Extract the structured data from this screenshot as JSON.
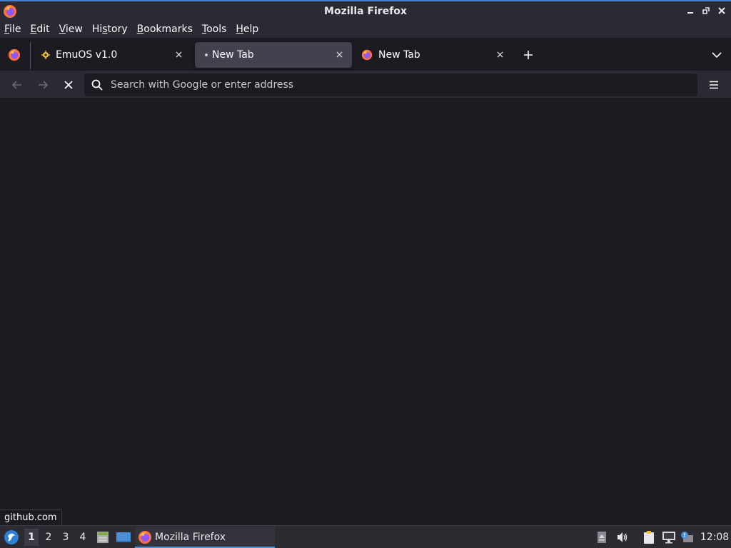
{
  "window": {
    "title": "Mozilla Firefox",
    "accent_color": "#4a7fc9"
  },
  "menubar": {
    "items": [
      {
        "first": "F",
        "rest": "ile"
      },
      {
        "first": "E",
        "rest": "dit"
      },
      {
        "first": "V",
        "rest": "iew"
      },
      {
        "first": "",
        "mid_pre": "Hi",
        "mid_ul": "s",
        "rest": "tory"
      },
      {
        "first": "B",
        "rest": "ookmarks"
      },
      {
        "first": "T",
        "rest": "ools"
      },
      {
        "first": "H",
        "rest": "elp"
      }
    ]
  },
  "tabs": [
    {
      "label": "EmuOS v1.0",
      "icon": "emuos-favicon",
      "active": false
    },
    {
      "label": "New Tab",
      "icon": "loading-dot",
      "active": true
    },
    {
      "label": "New Tab",
      "icon": "firefox-icon",
      "active": false
    }
  ],
  "navbar": {
    "url_placeholder": "Search with Google or enter address",
    "url_value": ""
  },
  "status_text": "github.com",
  "taskbar": {
    "workspaces": [
      "1",
      "2",
      "3",
      "4"
    ],
    "active_workspace": "1",
    "task_label": "Mozilla Firefox",
    "clock": "12:08"
  }
}
